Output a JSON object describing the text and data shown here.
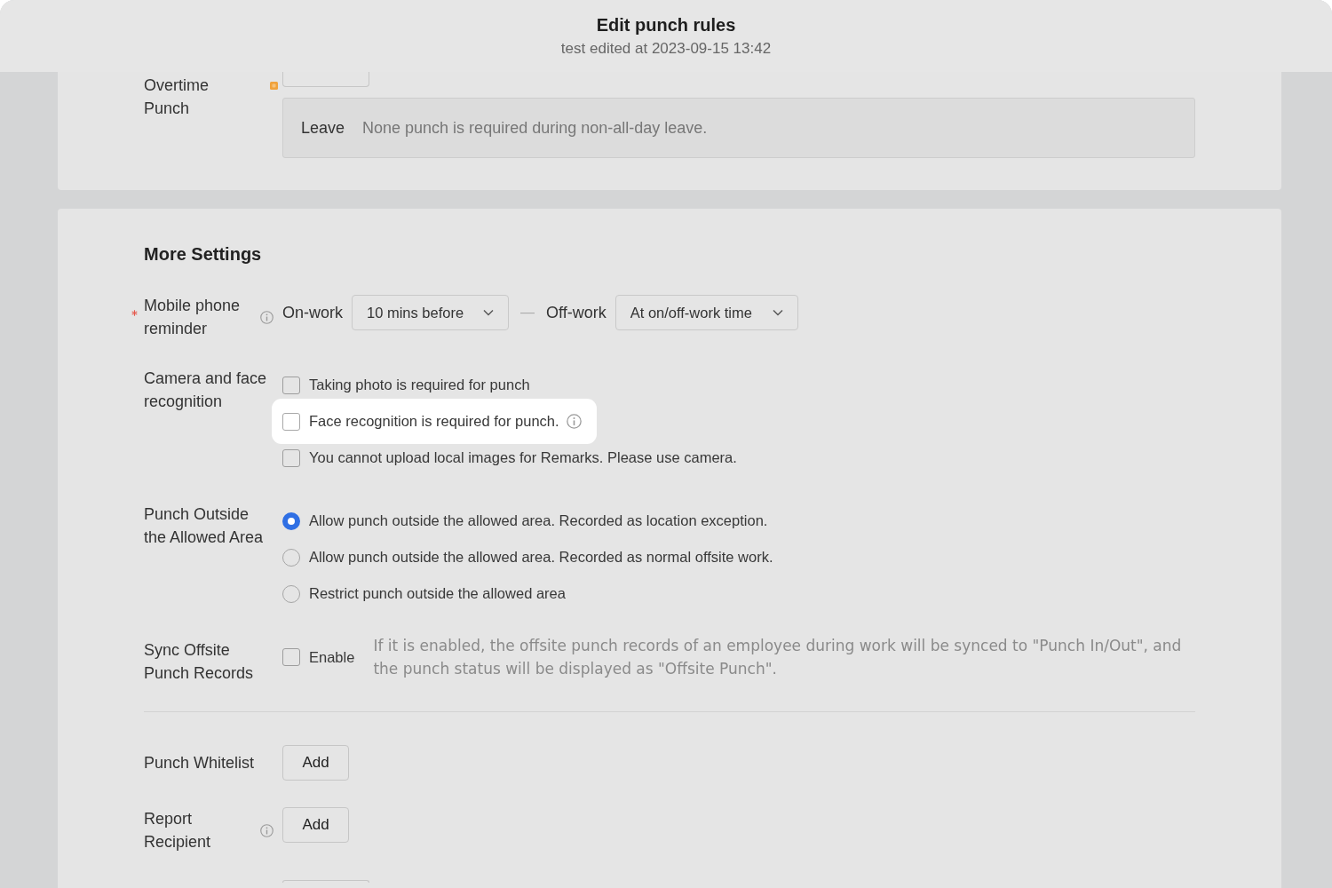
{
  "dialog": {
    "title": "Edit punch rules",
    "subtitle": "test edited at 2023-09-15 13:42"
  },
  "overtime": {
    "label": "Overtime Punch",
    "marker": true,
    "leave": {
      "label": "Leave",
      "text": "None punch is required during non-all-day leave."
    }
  },
  "more_settings": {
    "title": "More Settings",
    "groups": [
      {
        "rows": [
          {
            "kind": "reminder",
            "label": "Mobile phone reminder",
            "required": true,
            "info": true,
            "on_work": {
              "label": "On-work",
              "value": "10 mins before"
            },
            "separator": "—",
            "off_work": {
              "label": "Off-work",
              "value": "At on/off-work time"
            }
          },
          {
            "kind": "checkboxes",
            "label": "Camera and face recognition",
            "required": false,
            "info": false,
            "options": [
              {
                "label": "Taking photo is required for punch",
                "checked": false,
                "highlighted": false,
                "info": false
              },
              {
                "label": "Face recognition is required for punch.",
                "checked": false,
                "highlighted": true,
                "info": true
              },
              {
                "label": "You cannot upload local images for Remarks. Please use camera.",
                "checked": false,
                "highlighted": false,
                "info": false
              }
            ]
          },
          {
            "kind": "radios",
            "label": "Punch Outside the Allowed Area",
            "required": false,
            "info": false,
            "options": [
              {
                "label": "Allow punch outside the allowed area. Recorded as location exception.",
                "selected": true
              },
              {
                "label": "Allow punch outside the allowed area. Recorded as normal offsite work.",
                "selected": false
              },
              {
                "label": "Restrict punch outside the allowed area",
                "selected": false
              }
            ]
          },
          {
            "kind": "toggle_note",
            "label": "Sync Offsite Punch Records",
            "required": false,
            "info": false,
            "option": {
              "label": "Enable",
              "checked": false
            },
            "note": "If it is enabled, the offsite punch records of an employee during work will be synced to \"Punch In/Out\", and the punch status will be displayed as \"Offsite Punch\"."
          }
        ]
      },
      {
        "rows": [
          {
            "kind": "button",
            "label": "Punch Whitelist",
            "required": false,
            "info": false,
            "button": "Add"
          },
          {
            "kind": "button",
            "label": "Report Recipient",
            "required": false,
            "info": true,
            "button": "Add"
          }
        ]
      }
    ]
  }
}
